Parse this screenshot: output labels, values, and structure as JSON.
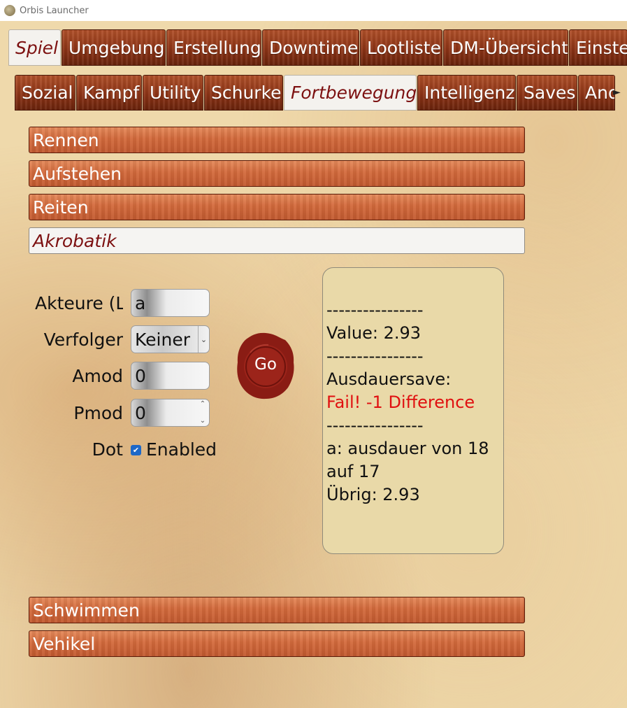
{
  "window": {
    "title": "Orbis Launcher",
    "icon": "orbis-app-icon"
  },
  "top_tabs": [
    {
      "label": "Spiel",
      "active": true
    },
    {
      "label": "Umgebung"
    },
    {
      "label": "Erstellung"
    },
    {
      "label": "Downtime"
    },
    {
      "label": "Lootliste"
    },
    {
      "label": "DM-Übersicht"
    },
    {
      "label": "Einstel"
    }
  ],
  "sub_tabs": [
    {
      "label": "Sozial"
    },
    {
      "label": "Kampf"
    },
    {
      "label": "Utility"
    },
    {
      "label": "Schurke"
    },
    {
      "label": "Fortbewegung",
      "active": true
    },
    {
      "label": "Intelligenz"
    },
    {
      "label": "Saves"
    },
    {
      "label": "Ande"
    }
  ],
  "sections_above": [
    {
      "label": "Rennen"
    },
    {
      "label": "Aufstehen"
    },
    {
      "label": "Reiten"
    }
  ],
  "open_section": {
    "label": "Akrobatik"
  },
  "form": {
    "actors_label": "Akteure (L",
    "actors_value": "a",
    "pursuer_label": "Verfolger",
    "pursuer_value": "Keiner",
    "amod_label": "Amod",
    "amod_value": "0",
    "pmod_label": "Pmod",
    "pmod_value": "0",
    "dot_label": "Dot",
    "dot_checked": true,
    "dot_checkbox_label": "Enabled",
    "go_label": "Go"
  },
  "output": {
    "lines": [
      {
        "text": "----------------"
      },
      {
        "text": "Value: 2.93"
      },
      {
        "text": "----------------"
      },
      {
        "text": "Ausdauersave:"
      },
      {
        "text": "Fail! -1 Difference",
        "error": true
      },
      {
        "text": "----------------"
      },
      {
        "text": "a: ausdauer von 18"
      },
      {
        "text": "auf 17"
      },
      {
        "text": "Übrig: 2.93"
      }
    ],
    "error_color": "#e01010"
  },
  "sections_below": [
    {
      "label": "Schwimmen"
    },
    {
      "label": "Vehikel"
    }
  ],
  "colors": {
    "wood": "#9a3c18",
    "active_tab_text": "#7c1010",
    "panel_bg": "#e9d9a8"
  }
}
